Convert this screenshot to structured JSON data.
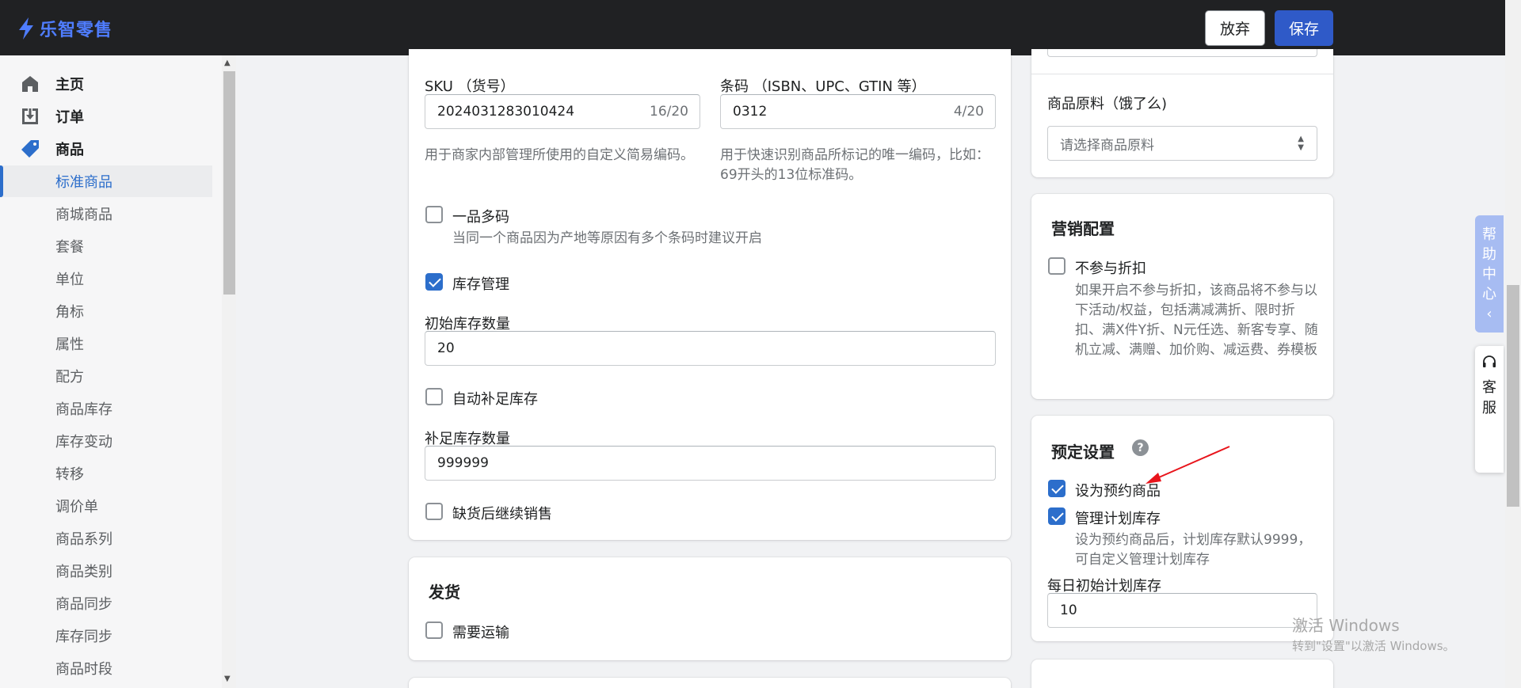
{
  "app": {
    "logo_text": "乐智零售"
  },
  "toolbar": {
    "discard_label": "放弃",
    "save_label": "保存"
  },
  "sidebar": {
    "nav": [
      {
        "label": "主页",
        "icon": "home-icon"
      },
      {
        "label": "订单",
        "icon": "order-download-icon"
      },
      {
        "label": "商品",
        "icon": "tag-icon"
      }
    ],
    "sub_items": [
      "标准商品",
      "商城商品",
      "套餐",
      "单位",
      "角标",
      "属性",
      "配方",
      "商品库存",
      "库存变动",
      "转移",
      "调价单",
      "商品系列",
      "商品类别",
      "商品同步",
      "库存同步",
      "商品时段"
    ],
    "active_sub": "标准商品"
  },
  "inventory": {
    "sku_label": "SKU （货号）",
    "sku_value": "2024031283010424",
    "sku_count": "16/20",
    "sku_help": "用于商家内部管理所使用的自定义简易编码。",
    "barcode_label": "条码 （ISBN、UPC、GTIN 等）",
    "barcode_value": "0312",
    "barcode_count": "4/20",
    "barcode_help": "用于快速识别商品所标记的唯一编码，比如：69开头的13位标准码。",
    "multi_code_label": "一品多码",
    "multi_code_help": "当同一个商品因为产地等原因有多个条码时建议开启",
    "multi_code_checked": false,
    "stock_mgmt_label": "库存管理",
    "stock_mgmt_checked": true,
    "initial_stock_label": "初始库存数量",
    "initial_stock_value": "20",
    "auto_replenish_label": "自动补足库存",
    "auto_replenish_checked": false,
    "replenish_qty_label": "补足库存数量",
    "replenish_qty_value": "999999",
    "oversell_label": "缺货后继续销售",
    "oversell_checked": false
  },
  "shipping": {
    "title": "发货",
    "needs_shipping_label": "需要运输",
    "needs_shipping_checked": false
  },
  "ingredient": {
    "label": "商品原料（饿了么)",
    "placeholder": "请选择商品原料"
  },
  "marketing": {
    "title": "营销配置",
    "no_discount_label": "不参与折扣",
    "no_discount_checked": false,
    "no_discount_help": "如果开启不参与折扣，该商品将不参与以下活动/权益，包括满减满折、限时折扣、满X件Y折、N元任选、新客专享、随机立减、满赠、加价购、减运费、券模板"
  },
  "preorder": {
    "title": "预定设置",
    "set_preorder_label": "设为预约商品",
    "set_preorder_checked": true,
    "plan_stock_label": "管理计划库存",
    "plan_stock_checked": true,
    "plan_stock_help": "设为预约商品后，计划库存默认9999，可自定义管理计划库存",
    "daily_stock_label": "每日初始计划库存",
    "daily_stock_value": "10"
  },
  "floating": {
    "help_center": [
      "帮",
      "助",
      "中",
      "心",
      "‹"
    ],
    "customer_service": [
      "客",
      "服"
    ]
  },
  "watermark": {
    "line1": "激活 Windows",
    "line2": "转到\"设置\"以激活 Windows。"
  },
  "colors": {
    "accent": "#2c6ecb",
    "topbar": "#202123",
    "save_button": "#2f5ac8",
    "annotation_arrow": "#e8141b"
  }
}
